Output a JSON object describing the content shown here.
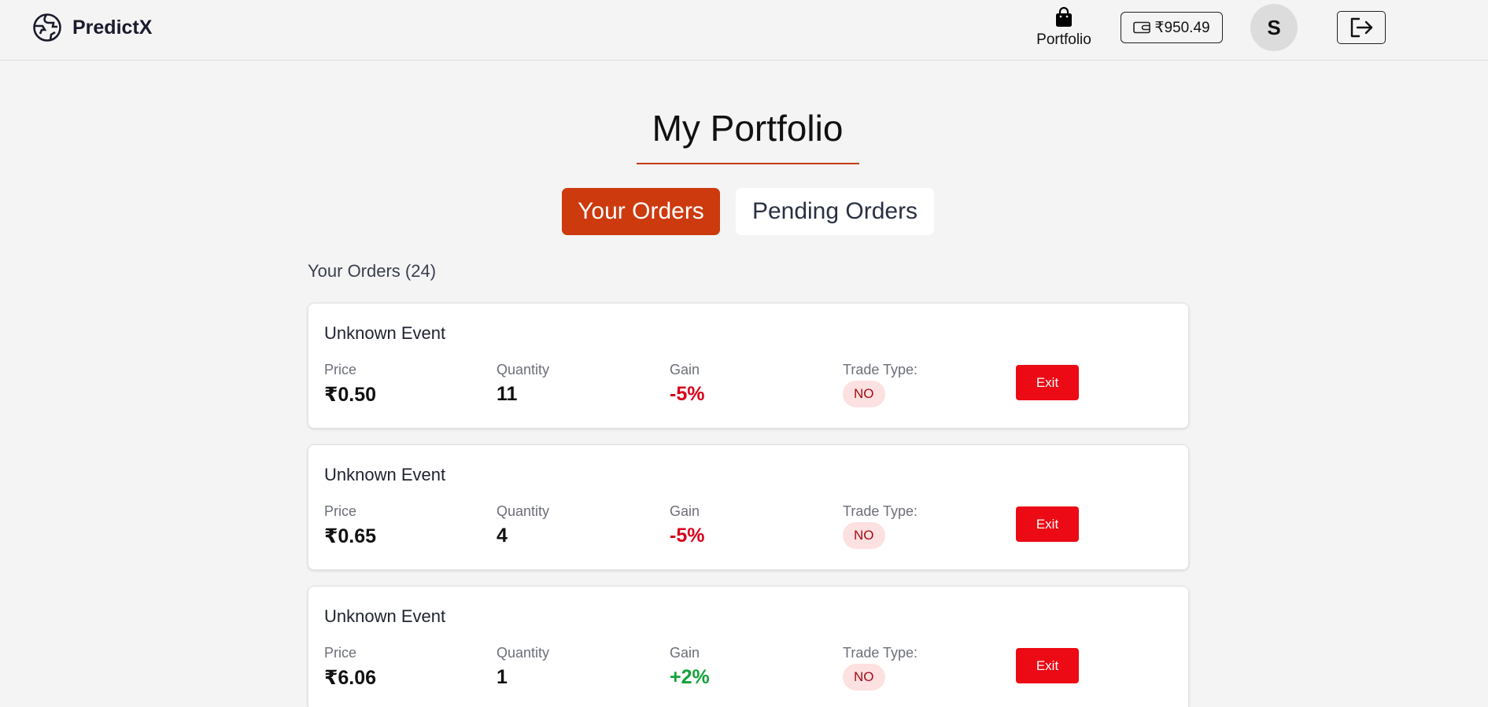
{
  "header": {
    "app_name": "PredictX",
    "portfolio_label": "Portfolio",
    "wallet_balance": "₹950.49",
    "avatar_initial": "S",
    "icons": {
      "logo": "globe-logo-icon",
      "portfolio": "shopping-bag-icon",
      "wallet": "wallet-icon",
      "logout": "logout-icon"
    }
  },
  "page": {
    "title": "My Portfolio",
    "tabs": [
      {
        "label": "Your Orders",
        "active": true
      },
      {
        "label": "Pending Orders",
        "active": false
      }
    ],
    "orders_heading": "Your Orders (24)"
  },
  "orders": [
    {
      "title": "Unknown Event",
      "price_label": "Price",
      "price": "₹0.50",
      "qty_label": "Quantity",
      "qty": "11",
      "gain_label": "Gain",
      "gain": "-5%",
      "type_label": "Trade Type:",
      "type": "NO",
      "exit_label": "Exit"
    },
    {
      "title": "Unknown Event",
      "price_label": "Price",
      "price": "₹0.65",
      "qty_label": "Quantity",
      "qty": "4",
      "gain_label": "Gain",
      "gain": "-5%",
      "type_label": "Trade Type:",
      "type": "NO",
      "exit_label": "Exit"
    },
    {
      "title": "Unknown Event",
      "price_label": "Price",
      "price": "₹6.06",
      "qty_label": "Quantity",
      "qty": "1",
      "gain_label": "Gain",
      "gain": "+2%",
      "type_label": "Trade Type:",
      "type": "NO",
      "exit_label": "Exit"
    }
  ],
  "colors": {
    "accent": "#cc3a0e",
    "exit": "#ec0a14",
    "loss": "#d8001a",
    "gain": "#12a33a"
  }
}
